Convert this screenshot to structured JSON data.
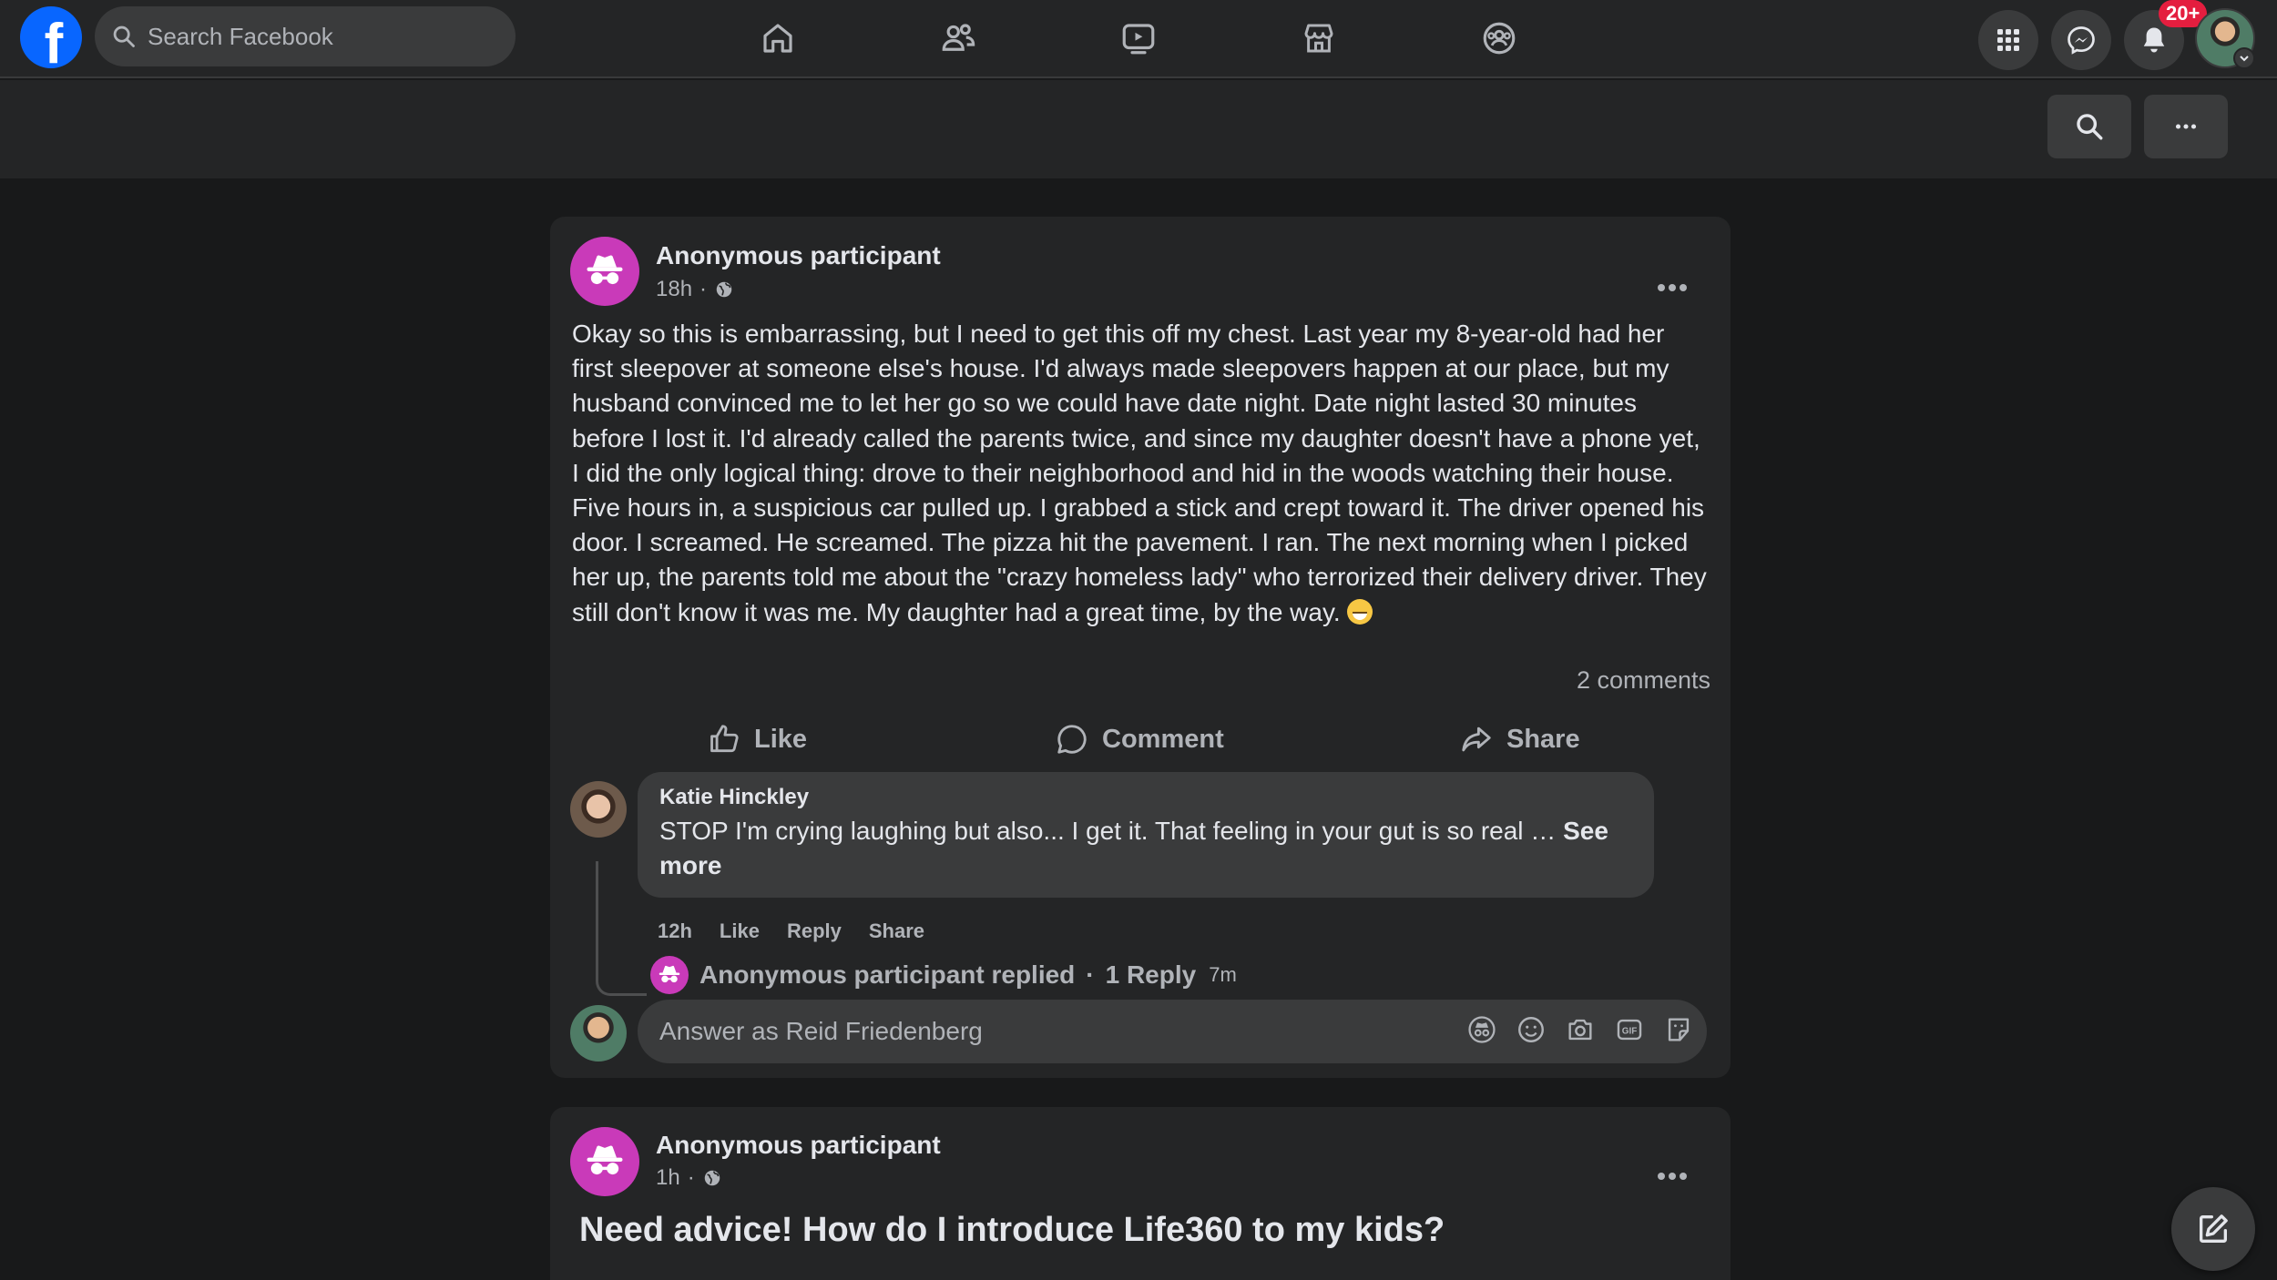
{
  "header": {
    "logo_letter": "f",
    "search_placeholder": "Search Facebook",
    "notifications_badge": "20+"
  },
  "post1": {
    "author": "Anonymous participant",
    "time": "18h",
    "body": "Okay so this is embarrassing, but I need to get this off my chest. Last year my 8-year-old had her first sleepover at someone else's house. I'd always made sleepovers happen at our place, but my husband convinced me to let her go so we could have date night. Date night lasted 30 minutes before I lost it. I'd already called the parents twice, and since my daughter doesn't have a phone yet, I did the only logical thing: drove to their neighborhood and hid in the woods watching their house. Five hours in, a suspicious car pulled up. I grabbed a stick and crept toward it. The driver opened his door. I screamed. He screamed. The pizza hit the pavement. I ran. The next morning when I picked her up, the parents told me about the \"crazy homeless lady\" who terrorized their delivery driver. They still don't know it was me. My daughter had a great time, by the way.",
    "comments_count": "2 comments",
    "actions": {
      "like": "Like",
      "comment": "Comment",
      "share": "Share"
    },
    "comment": {
      "author": "Katie Hinckley",
      "text": "STOP I'm crying laughing but also... I get it. That feeling in your gut is so real",
      "ellipsis": " … ",
      "see_more": "See more",
      "time": "12h",
      "like": "Like",
      "reply": "Reply",
      "share": "Share"
    },
    "replied": {
      "text": "Anonymous participant replied",
      "separator": "·",
      "count": "1 Reply",
      "time": "7m"
    },
    "answer_placeholder": "Answer as Reid Friedenberg"
  },
  "post2": {
    "author": "Anonymous participant",
    "time": "1h",
    "title": "Need advice! How do I introduce Life360 to my kids?"
  },
  "colors": {
    "background": "#18191a",
    "surface": "#242526",
    "input": "#3a3b3c",
    "brand": "#0866ff",
    "anon_avatar": "#c93ab9",
    "badge": "#e41e3f"
  }
}
